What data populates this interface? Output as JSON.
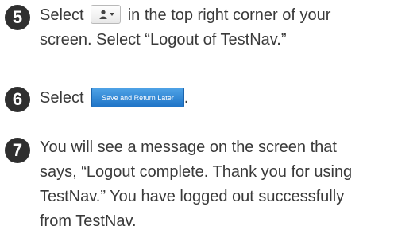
{
  "steps": [
    {
      "number": "5",
      "text_before": "Select",
      "text_after": "in the top right corner of your",
      "line2": "screen. Select “Logout of TestNav.”"
    },
    {
      "number": "6",
      "text_before": "Select",
      "button_label": "Save and Return Later",
      "text_after": "."
    },
    {
      "number": "7",
      "lines": [
        "You will see a message on the screen that",
        "says, “Logout complete. Thank you for using",
        "TestNav.” You have logged out successfully",
        "from TestNav."
      ]
    }
  ],
  "icons": {
    "user_menu_button": "user-dropdown-icon"
  },
  "colors": {
    "step_badge": "#2f2f2f",
    "body_text": "#3a3a3a",
    "save_button": "#2a82d6"
  }
}
